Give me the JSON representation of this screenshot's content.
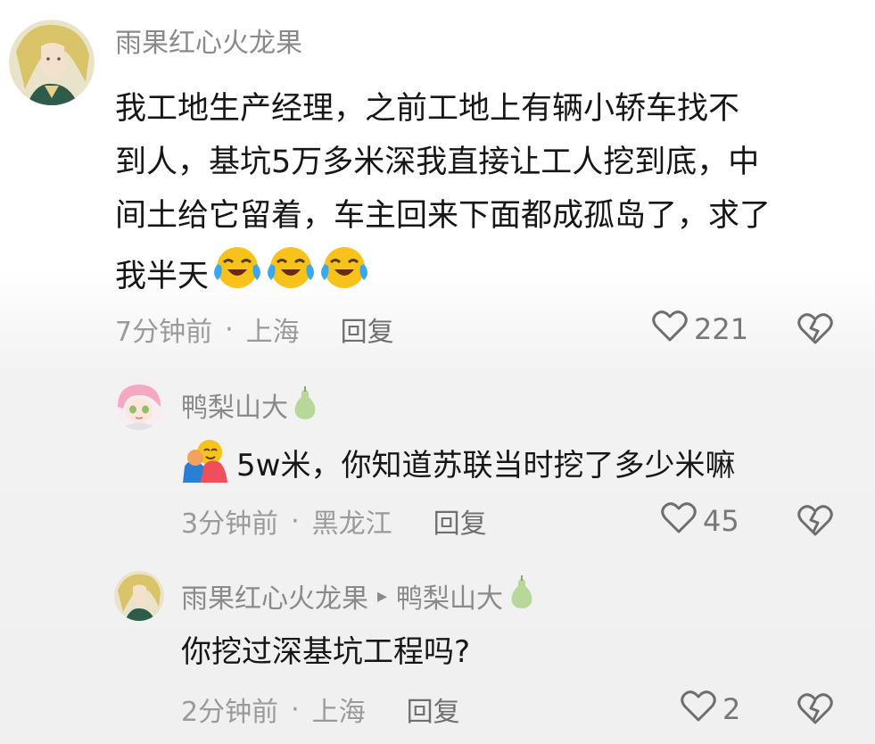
{
  "comments": [
    {
      "username": "雨果红心火龙果",
      "text_lines": [
        "我工地生产经理，之前工地上有辆小轿车找不",
        "到人，基坑5万多米深我直接让工人挖到底，中",
        "间土给它留着，车主回来下面都成孤岛了，求了"
      ],
      "text_last": "我半天",
      "emojis": [
        "crying-laughing-emoji",
        "crying-laughing-emoji",
        "crying-laughing-emoji"
      ],
      "time": "7分钟前",
      "separator": "·",
      "location": "上海",
      "reply_label": "回复",
      "likes": "221"
    },
    {
      "username": "鸭梨山大",
      "badge_icon": "pear-icon",
      "emoji": "hugging-emoji",
      "text": "5w米，你知道苏联当时挖了多少米嘛",
      "time": "3分钟前",
      "separator": "·",
      "location": "黑龙江",
      "reply_label": "回复",
      "likes": "45"
    },
    {
      "username": "雨果红心火龙果",
      "reply_arrow": "▸",
      "reply_to": "鸭梨山大",
      "badge_icon": "pear-icon",
      "text": "你挖过深基坑工程吗?",
      "time": "2分钟前",
      "separator": "·",
      "location": "上海",
      "reply_label": "回复",
      "likes": "2"
    }
  ],
  "colors": {
    "text": "#161616",
    "username": "#8a8a8a",
    "meta": "#9a9a9a",
    "icon": "#6e6e6e",
    "pear": "#b8d89a",
    "emoji_yellow": "#f7c21a",
    "emoji_tear": "#38a8f0"
  }
}
